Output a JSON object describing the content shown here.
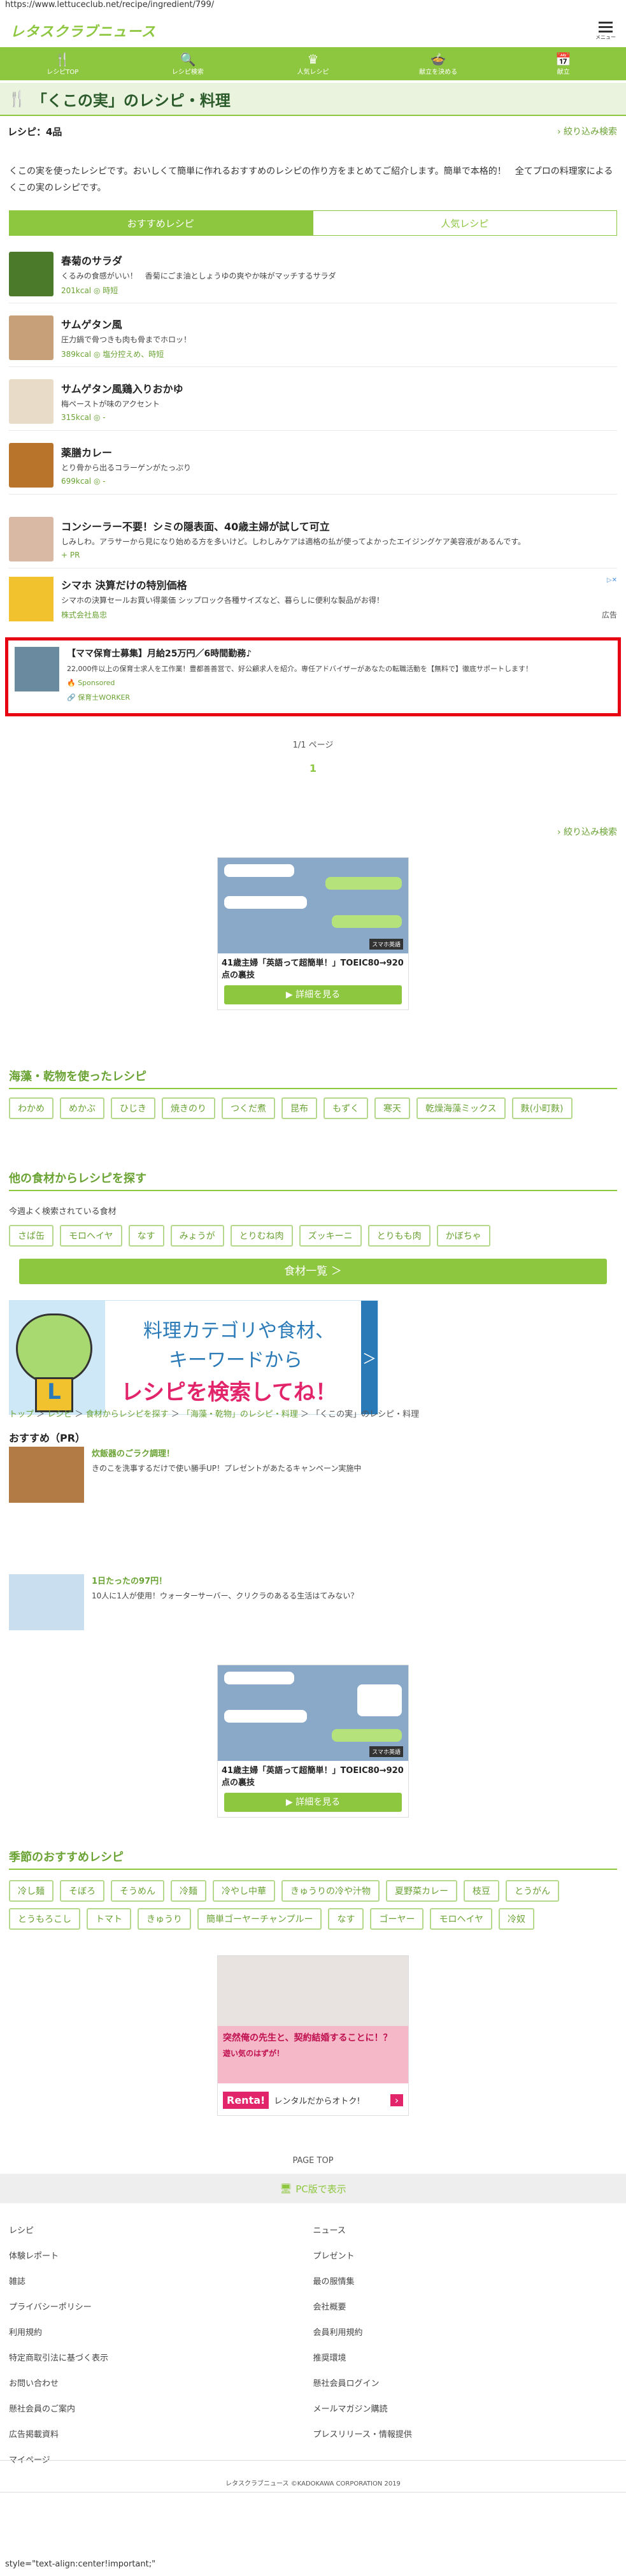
{
  "url": "https://www.lettuceclub.net/recipe/ingredient/799/",
  "header": {
    "logo": "レタスクラブニュース",
    "menu_label": "メニュー"
  },
  "gnav": [
    {
      "label": "レシピTOP",
      "icon": "fork-knife-icon",
      "glyph": "🍴"
    },
    {
      "label": "レシピ検索",
      "icon": "search-icon",
      "glyph": "🔍"
    },
    {
      "label": "人気レシピ",
      "icon": "crown-icon",
      "glyph": "♛"
    },
    {
      "label": "献立を決める",
      "icon": "pot-icon",
      "glyph": "🍲"
    },
    {
      "label": "献立",
      "icon": "calendar-icon",
      "glyph": "📅"
    }
  ],
  "page_title": "「くこの実」のレシピ・料理",
  "recipe_count": "レシピ：4品",
  "filter_label": "絞り込み検索",
  "lead": "くこの実を使ったレシピです。おいしくて簡単に作れるおすすめのレシピの作り方をまとめてご紹介します。簡単で本格的！　全てプロの料理家によるくこの実のレシピです。",
  "tabs": {
    "recommended": "おすすめレシピ",
    "popular": "人気レシピ"
  },
  "recipes": [
    {
      "title": "春菊のサラダ",
      "desc": "くるみの食感がいい！　香菊にごま油としょうゆの爽やか味がマッチするサラダ",
      "meta": "201kcal ◎ 時短",
      "color": "#4a7a2a"
    },
    {
      "title": "サムゲタン風",
      "desc": "圧力鍋で骨つきも肉も骨までホロッ！",
      "meta": "389kcal ◎ 塩分控えめ、時短",
      "color": "#c7a07a"
    },
    {
      "title": "サムゲタン風鶏入りおかゆ",
      "desc": "梅ペーストが味のアクセント",
      "meta": "315kcal ◎ -",
      "color": "#e8dcc8"
    },
    {
      "title": "薬膳カレー",
      "desc": "とり骨から出るコラーゲンがたっぷり",
      "meta": "699kcal ◎ -",
      "color": "#b8742a"
    }
  ],
  "ad1": {
    "title": "コンシーラー不要！シミの隠表面、40歳主婦が試して可立",
    "desc": "しみしわ。アラサーから見になり始める方を多いけど。しわしみケアは適格の払が使ってよかったエイジングケア美容液があるんです。",
    "meta": "PR",
    "color": "#d9b8a4"
  },
  "ad2": {
    "title": "シマホ 決算だけの特別価格",
    "desc": "シマホの決算セールお買い得薬価 シップロック各種サイズなど、暮らしに便利な製品がお得！",
    "advertiser": "株式会社島忠",
    "label": "広告",
    "color": "#f2c12e"
  },
  "sponsored": {
    "title": "【ママ保育士募集】月給25万円／6時間勤務♪",
    "desc": "22,000件以上の保育士求人を工作業！豊都善善営で、好公顧求人を紹介。専任アドバイザーがあなたの転職活動を【無料で】徹底サポートします！",
    "badge": "Sponsored",
    "advertiser": "保育士WORKER",
    "color": "#6a8aa0"
  },
  "pager": {
    "text": "1/1 ページ",
    "current": "1"
  },
  "line_ad": {
    "title": "41歳主婦「英語って超簡単！」TOEIC80→920点の裏技",
    "button": "▶ 詳細を見る",
    "brand": "スマホ英語"
  },
  "kaiso": {
    "heading": "海藻・乾物を使ったレシピ",
    "items": [
      "わかめ",
      "めかぶ",
      "ひじき",
      "焼きのり",
      "つくだ煮",
      "昆布",
      "もずく",
      "寒天",
      "乾燥海藻ミックス",
      "麩(小町麩)"
    ]
  },
  "other": {
    "heading": "他の食材からレシピを探す",
    "sub": "今週よく検索されている食材",
    "items": [
      "さば缶",
      "モロヘイヤ",
      "なす",
      "みょうが",
      "とりむね肉",
      "ズッキーニ",
      "とりもも肉",
      "かぼちゃ"
    ],
    "button": "食材一覧 ＞"
  },
  "search_banner": {
    "line1": "料理カテゴリや食材、",
    "line2": "キーワードから",
    "line3": "レシピを検索してね！",
    "arrow": "＞",
    "mascot_letter": "L"
  },
  "breadcrumb": [
    "トップ",
    "レシピ",
    "食材からレシピを探す",
    "「海藻・乾物」のレシピ・料理",
    "「くこの実」のレシピ・料理"
  ],
  "pr": {
    "heading": "おすすめ（PR）",
    "items": [
      {
        "title": "炊飯器のごラク調理！",
        "desc": "きのこを洗事するだけで使い勝手UP！プレゼントがあたるキャンペーン実施中",
        "color": "#b27a44"
      },
      {
        "title": "1日たったの97円！",
        "desc": "10人に1人が使用！ウォーターサーバー、クリクラのあるる生活はてみない？",
        "color": "#c9dff0"
      }
    ]
  },
  "season": {
    "heading": "季節のおすすめレシピ",
    "items": [
      "冷し麺",
      "そぼろ",
      "そうめん",
      "冷麺",
      "冷やし中華",
      "きゅうりの冷や汁物",
      "夏野菜カレー",
      "枝豆",
      "とうがん",
      "とうもろこし",
      "トマト",
      "きゅうり",
      "簡単ゴーヤーチャンプルー",
      "なす",
      "ゴーヤー",
      "モロヘイヤ",
      "冷奴"
    ]
  },
  "manga": {
    "caption": "突然俺の先生と、契約結婚することに！？",
    "sub": "遊い気のはずが！",
    "brand": "Renta!",
    "brand_sub": "レンタルだからオトク!",
    "arrow": "›"
  },
  "footer": {
    "pagetop": "PAGE TOP",
    "pc": "PC版で表示",
    "links": [
      "レシピ",
      "ニュース",
      "体験レポート",
      "プレゼント",
      "雑誌",
      "最の服情集",
      "プライバシーポリシー",
      "会社概要",
      "利用規約",
      "会員利用規約",
      "特定商取引法に基づく表示",
      "推奨環境",
      "お問い合わせ",
      "懸社会員ログイン",
      "懸社会員のご案内",
      "メールマガジン購読",
      "広告掲載資料",
      "プレスリリース・情報提供",
      "マイページ"
    ],
    "copyright": "レタスクラブニュース ©KADOKAWA CORPORATION 2019"
  },
  "bottom_text": "style=\"text-align:center!important;\"",
  "colors": {
    "brand": "#8dc63f",
    "highlight_border": "#e60012"
  }
}
